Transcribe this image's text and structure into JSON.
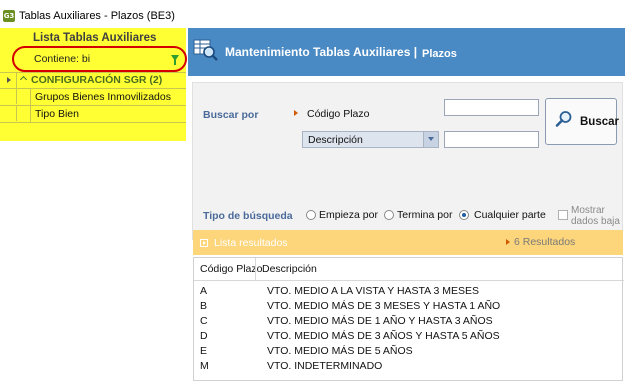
{
  "window": {
    "title": "Tablas Auxiliares - Plazos (BE3)",
    "icon_text": "G3"
  },
  "left_panel": {
    "header": "Lista Tablas Auxiliares",
    "filter_text": "Contiene: bi",
    "group_label": "CONFIGURACIÓN SGR (2)",
    "items": [
      {
        "label": "Grupos Bienes Inmovilizados"
      },
      {
        "label": "Tipo Bien"
      }
    ],
    "highlight_color": "#ffff33"
  },
  "main": {
    "title": "Mantenimiento Tablas Auxiliares",
    "separator": "|",
    "subtitle": "Plazos",
    "header_color": "#4a8ac4",
    "search": {
      "label_buscar_por": "Buscar por",
      "field_codigo_label": "Código Plazo",
      "field_codigo_value": "",
      "select_selected": "Descripción",
      "field_desc_value": "",
      "button_label": "Buscar",
      "label_tipo": "Tipo de búsqueda",
      "options": [
        {
          "label": "Empieza por",
          "checked": false
        },
        {
          "label": "Termina por",
          "checked": false
        },
        {
          "label": "Cualquier parte",
          "checked": true
        }
      ],
      "show_low_label_1": "Mostrar",
      "show_low_label_2": "dados baja"
    },
    "results": {
      "title": "Lista resultados",
      "count": "6 Resultados",
      "bar_color": "#fdd57a",
      "columns": [
        "Código Plazo",
        "Descripción"
      ],
      "rows": [
        {
          "code": "A",
          "desc": "VTO. MEDIO A LA VISTA Y HASTA 3 MESES"
        },
        {
          "code": "B",
          "desc": "VTO. MEDIO MÁS DE 3 MESES Y HASTA 1 AÑO"
        },
        {
          "code": "C",
          "desc": "VTO. MEDIO MÁS DE 1 AÑO Y HASTA 3 AÑOS"
        },
        {
          "code": "D",
          "desc": "VTO. MEDIO MÁS DE 3 AÑOS Y HASTA 5 AÑOS"
        },
        {
          "code": "E",
          "desc": "VTO. MEDIO MÁS DE 5 AÑOS"
        },
        {
          "code": "M",
          "desc": "VTO. INDETERMINADO"
        }
      ]
    }
  }
}
